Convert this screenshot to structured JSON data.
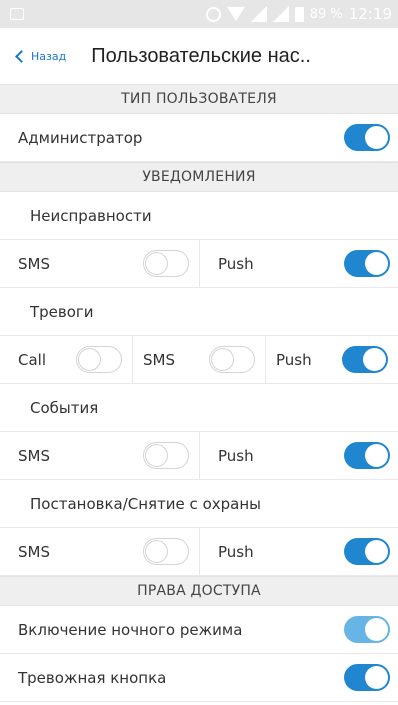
{
  "status_bar": {
    "battery": "89 %",
    "time": "12:19"
  },
  "nav": {
    "back_label": "Назад",
    "title": "Пользовательские нас.."
  },
  "user_type": {
    "header": "ТИП ПОЛЬЗОВАТЕЛЯ",
    "admin": {
      "label": "Администратор",
      "on": true
    }
  },
  "notifications": {
    "header": "УВЕДОМЛЕНИЯ",
    "faults": {
      "title": "Неисправности",
      "sms": "SMS",
      "push": "Push",
      "sms_on": false,
      "push_on": true
    },
    "alarms": {
      "title": "Тревоги",
      "call": "Call",
      "sms": "SMS",
      "push": "Push",
      "call_on": false,
      "sms_on": false,
      "push_on": true
    },
    "events": {
      "title": "События",
      "sms": "SMS",
      "push": "Push",
      "sms_on": false,
      "push_on": true
    },
    "arming": {
      "title": "Постановка/Снятие с охраны",
      "sms": "SMS",
      "push": "Push",
      "sms_on": false,
      "push_on": true
    }
  },
  "access": {
    "header": "ПРАВА ДОСТУПА",
    "night_mode": {
      "label": "Включение ночного режима",
      "on": true
    },
    "panic_button": {
      "label": "Тревожная кнопка",
      "on": true
    }
  },
  "colors": {
    "accent": "#1f86cf",
    "accent_light": "#66b5e4",
    "section_bg": "#efefef",
    "status_bar_bg": "#e6e6e6"
  }
}
